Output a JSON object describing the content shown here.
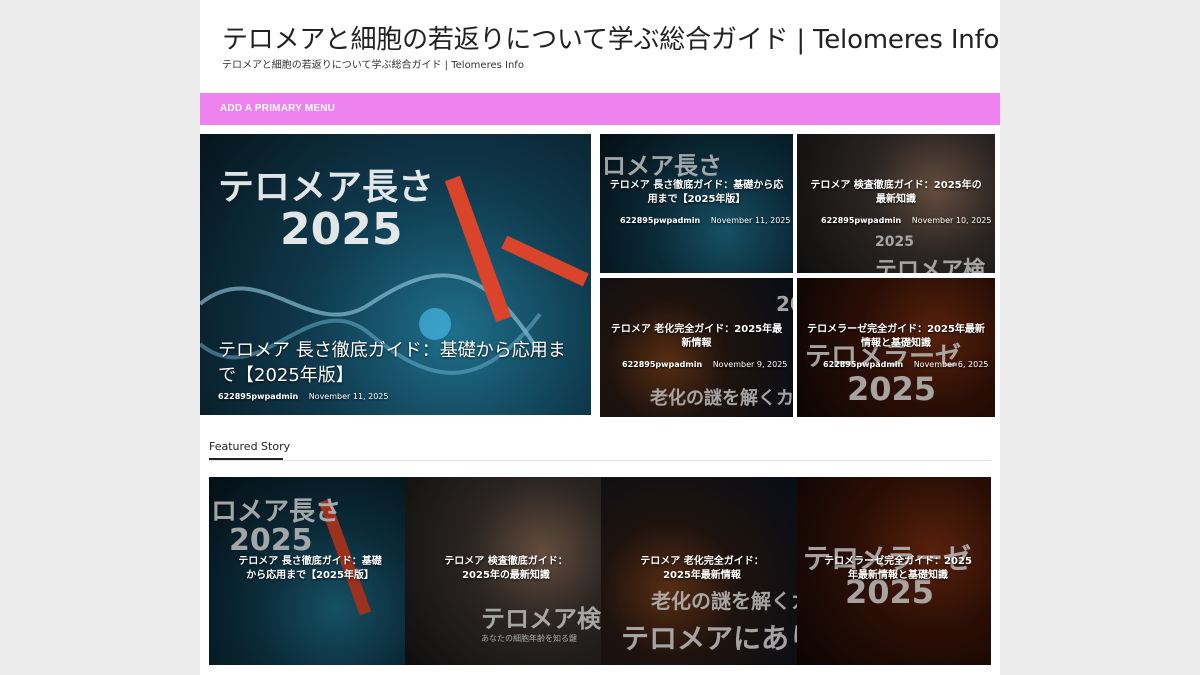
{
  "header": {
    "site_title": "テロメアと細胞の若返りについて学ぶ総合ガイド | Telomeres Info",
    "site_description": "テロメアと細胞の若返りについて学ぶ総合ガイド | Telomeres Info"
  },
  "menu": {
    "label": "ADD A PRIMARY MENU",
    "color": "#ee82ee"
  },
  "hero": {
    "main": {
      "image_text_1": "テロメア長さ",
      "image_text_2": "2025",
      "title": "テロメア 長さ徹底ガイド：基礎から応用まで【2025年版】",
      "author": "622895pwpadmin",
      "date": "November 11, 2025"
    },
    "grid": [
      {
        "image_text": "ロメア長さ",
        "title": "テロメア 長さ徹底ガイド：基礎から応用まで【2025年版】",
        "author": "622895pwpadmin",
        "date": "November 11, 2025"
      },
      {
        "image_text": "テロメア検",
        "image_text_2": "2025",
        "title": "テロメア 検査徹底ガイド：2025年の最新知識",
        "author": "622895pwpadmin",
        "date": "November 10, 2025"
      },
      {
        "image_text": "老化の謎を解くカ",
        "image_text_2": "20",
        "title": "テロメア 老化完全ガイド：2025年最新情報",
        "author": "622895pwpadmin",
        "date": "November 9, 2025"
      },
      {
        "image_text": "テロメラーゼ",
        "image_text_2": "2025",
        "title": "テロメラーゼ完全ガイド：2025年最新情報と基礎知識",
        "author": "622895pwpadmin",
        "date": "November 6, 2025"
      }
    ]
  },
  "featured": {
    "heading": "Featured Story",
    "items": [
      {
        "image_text": "ロメア長さ",
        "image_text_2": "2025",
        "title": "テロメア 長さ徹底ガイド：基礎から応用まで【2025年版】"
      },
      {
        "image_text": "テロメア検",
        "image_text_2": "あなたの細胞年齢を知る鍵",
        "title": "テロメア 検査徹底ガイド：2025年の最新知識"
      },
      {
        "image_text": "老化の謎を解くカ",
        "image_text_2": "テロメアにあり",
        "title": "テロメア 老化完全ガイド：2025年最新情報"
      },
      {
        "image_text": "テロメラーゼ",
        "image_text_2": "2025",
        "title": "テロメラーゼ完全ガイド：2025年最新情報と基礎知識"
      }
    ]
  }
}
